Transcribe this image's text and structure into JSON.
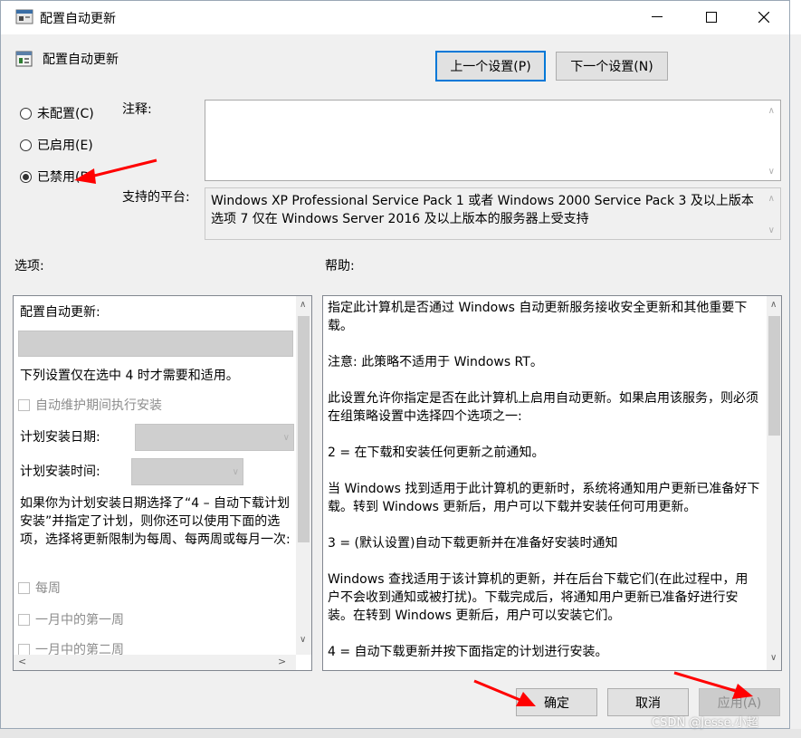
{
  "window": {
    "title": "配置自动更新",
    "minimize": "—",
    "maximize": "☐",
    "close": "✕"
  },
  "header": {
    "policy_name": "配置自动更新",
    "prev_button": "上一个设置(P)",
    "next_button": "下一个设置(N)"
  },
  "state": {
    "options": [
      {
        "label": "未配置(C)",
        "selected": false
      },
      {
        "label": "已启用(E)",
        "selected": false
      },
      {
        "label": "已禁用(D)",
        "selected": true
      }
    ],
    "comment_label": "注释:",
    "comment_value": "",
    "supported_label": "支持的平台:",
    "supported_text": "Windows XP Professional Service Pack 1 或者 Windows 2000 Service Pack 3 及以上版本 选项 7 仅在 Windows Server 2016 及以上版本的服务器上受支持"
  },
  "options_pane": {
    "title": "选项:",
    "heading": "配置自动更新:",
    "note": "下列设置仅在选中 4 时才需要和适用。",
    "maintenance_checkbox": "自动维护期间执行安装",
    "schedule_day_label": "计划安装日期:",
    "schedule_time_label": "计划安装时间:",
    "paragraph": "如果你为计划安装日期选择了“4 – 自动下载计划安装”并指定了计划，则你还可以使用下面的选项，选择将更新限制为每周、每两周或每月一次:",
    "weekly": "每周",
    "first_week": "一月中的第一周",
    "second_week": "一月中的第二周"
  },
  "help_pane": {
    "title": "帮助:",
    "paragraphs": [
      "指定此计算机是否通过 Windows 自动更新服务接收安全更新和其他重要下载。",
      "注意: 此策略不适用于 Windows RT。",
      "此设置允许你指定是否在此计算机上启用自动更新。如果启用该服务，则必须在组策略设置中选择四个选项之一:",
      "2 = 在下载和安装任何更新之前通知。",
      "当 Windows 找到适用于此计算机的更新时，系统将通知用户更新已准备好下载。转到 Windows 更新后，用户可以下载并安装任何可用更新。",
      "3 = (默认设置)自动下载更新并在准备好安装时通知",
      "Windows 查找适用于该计算机的更新，并在后台下载它们(在此过程中，用户不会收到通知或被打扰)。下载完成后，将通知用户更新已准备好进行安装。在转到 Windows 更新后，用户可以安装它们。",
      "4 = 自动下载更新并按下面指定的计划进行安装。"
    ]
  },
  "footer": {
    "ok": "确定",
    "cancel": "取消",
    "apply": "应用(A)"
  },
  "watermark": "CSDN @Jesse.小超",
  "colors": {
    "annotation_red": "#ff0000",
    "focus_blue": "#0078d7"
  }
}
